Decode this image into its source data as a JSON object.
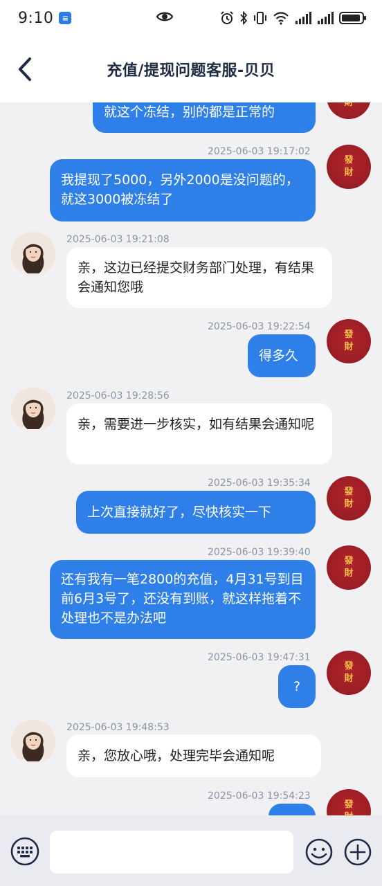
{
  "status_bar": {
    "time": "9:10",
    "app_icon_glyph": "≡",
    "icons": [
      "eye-icon",
      "alarm-icon",
      "bluetooth-icon",
      "vibrate-icon",
      "wifi-icon",
      "signal-icon",
      "signal-icon",
      "battery-icon"
    ]
  },
  "header": {
    "title": "充值/提现问题客服-贝贝",
    "back_icon": "chevron-left-icon"
  },
  "user_avatar": {
    "line1": "發",
    "line2": "財"
  },
  "messages": [
    {
      "id": 0,
      "sender": "user",
      "timestamp": "",
      "text": "就这个冻结，别的都是正常的"
    },
    {
      "id": 1,
      "sender": "user",
      "timestamp": "2025-06-03 19:17:02",
      "text": "我提现了5000，另外2000是没问题的，就这3000被冻结了"
    },
    {
      "id": 2,
      "sender": "agent",
      "timestamp": "2025-06-03 19:21:08",
      "text": "亲，这边已经提交财务部门处理，有结果会通知您哦"
    },
    {
      "id": 3,
      "sender": "user",
      "timestamp": "2025-06-03 19:22:54",
      "text": "得多久"
    },
    {
      "id": 4,
      "sender": "agent",
      "timestamp": "2025-06-03 19:28:56",
      "text": "亲，需要进一步核实，如有结果会通知呢"
    },
    {
      "id": 5,
      "sender": "user",
      "timestamp": "2025-06-03 19:35:34",
      "text": "上次直接就好了，尽快核实一下"
    },
    {
      "id": 6,
      "sender": "user",
      "timestamp": "2025-06-03 19:39:40",
      "text": "还有我有一笔2800的充值，4月31号到目前6月3号了，还没有到账，就这样拖着不处理也不是办法吧"
    },
    {
      "id": 7,
      "sender": "user",
      "timestamp": "2025-06-03 19:47:31",
      "text": "?"
    },
    {
      "id": 8,
      "sender": "agent",
      "timestamp": "2025-06-03 19:48:53",
      "text": "亲，您放心哦，处理完毕会通知呢"
    },
    {
      "id": 9,
      "sender": "user",
      "timestamp": "2025-06-03 19:54:23",
      "text": ""
    }
  ],
  "input_bar": {
    "placeholder": "",
    "left_icon": "keyboard-icon",
    "emoji_icon": "emoji-icon",
    "plus_icon": "plus-icon"
  },
  "colors": {
    "outgoing_bubble": "#2f7fe8",
    "incoming_bubble": "#ffffff",
    "background": "#f1f1f4",
    "user_avatar": "#a3202a",
    "user_avatar_text": "#f3c04a",
    "timestamp": "#8a93a3"
  }
}
